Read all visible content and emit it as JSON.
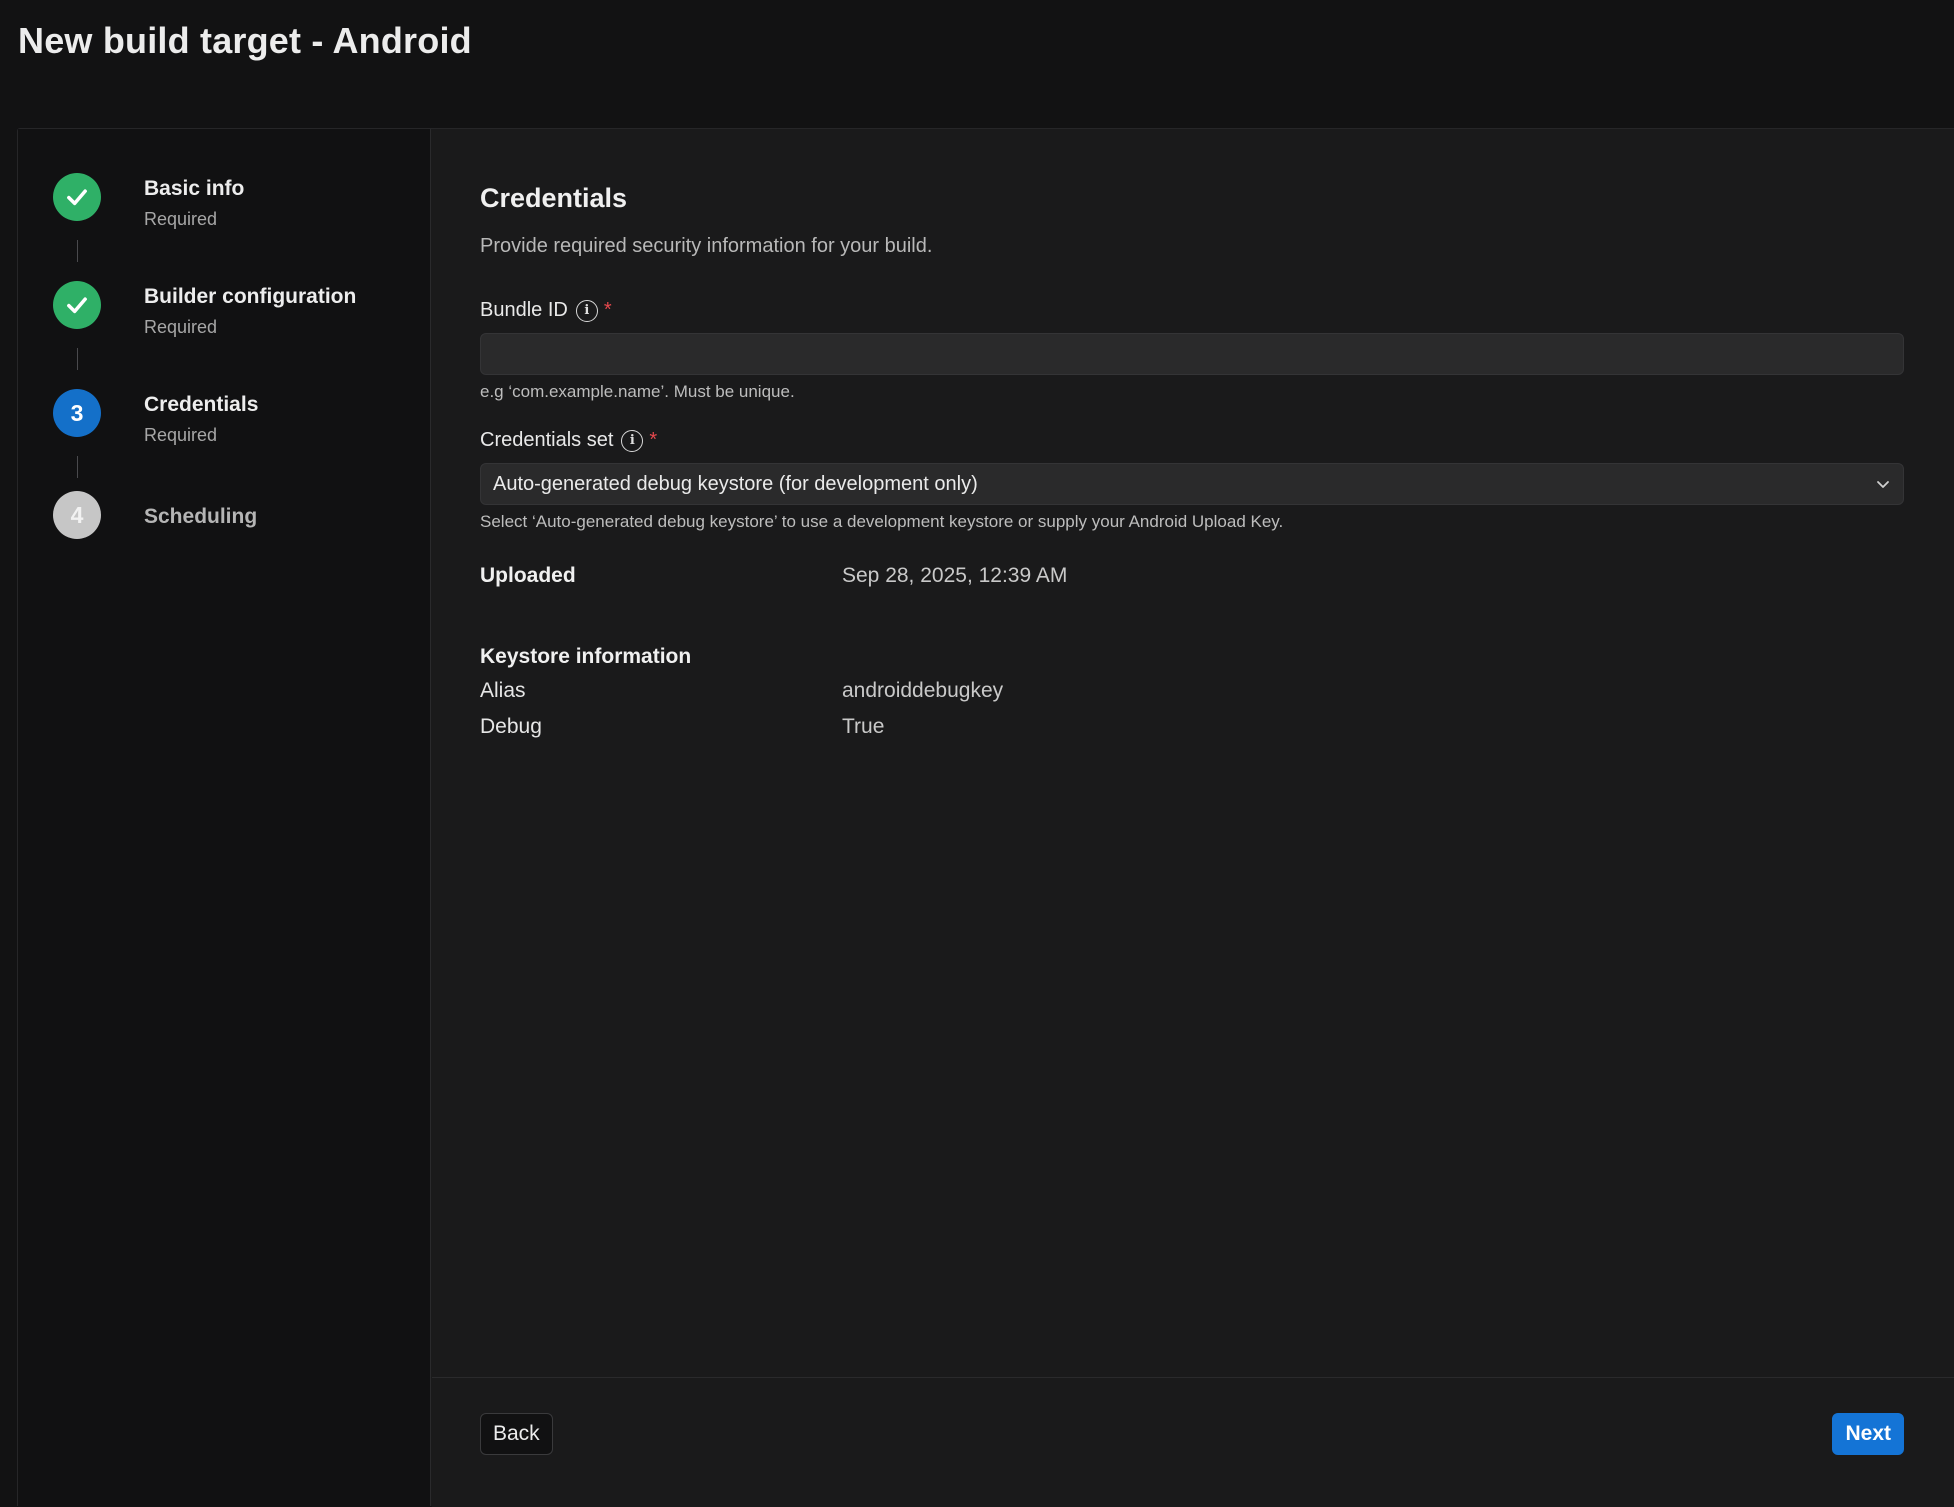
{
  "page": {
    "title": "New build target - Android"
  },
  "steps": [
    {
      "label": "Basic info",
      "sub": "Required",
      "state": "done",
      "number": "1"
    },
    {
      "label": "Builder configuration",
      "sub": "Required",
      "state": "done",
      "number": "2"
    },
    {
      "label": "Credentials",
      "sub": "Required",
      "state": "active",
      "number": "3"
    },
    {
      "label": "Scheduling",
      "sub": "",
      "state": "pending",
      "number": "4"
    }
  ],
  "credentials": {
    "title": "Credentials",
    "description": "Provide required security information for your build.",
    "bundle_id": {
      "label": "Bundle ID",
      "required_mark": "*",
      "value": "",
      "hint": "e.g ‘com.example.name’. Must be unique."
    },
    "credentials_set": {
      "label": "Credentials set",
      "required_mark": "*",
      "selected": "Auto-generated debug keystore (for development only)",
      "hint": "Select ‘Auto-generated debug keystore’ to use a development keystore or supply your Android Upload Key."
    },
    "uploaded": {
      "label": "Uploaded",
      "value": "Sep 28, 2025, 12:39 AM"
    },
    "keystore": {
      "heading": "Keystore information",
      "alias_label": "Alias",
      "alias_value": "androiddebugkey",
      "debug_label": "Debug",
      "debug_value": "True"
    }
  },
  "footer": {
    "back_label": "Back",
    "next_label": "Next"
  },
  "colors": {
    "accent": "#1474d6",
    "success": "#2fb067",
    "required": "#e5484d"
  }
}
